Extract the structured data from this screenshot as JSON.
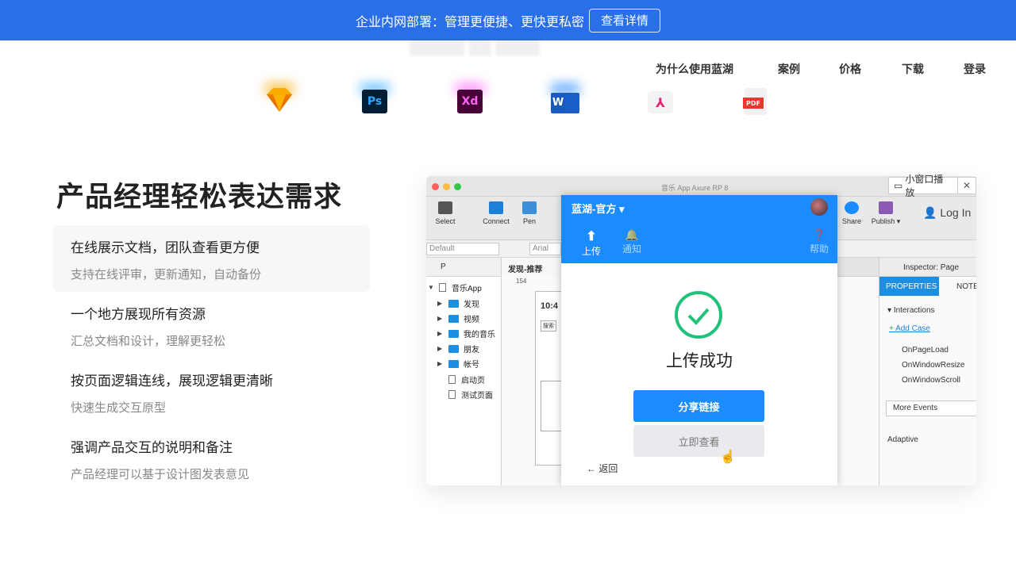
{
  "banner": {
    "text": "企业内网部署：管理更便捷、更快更私密",
    "button": "查看详情",
    "color": "#2b6fe8"
  },
  "nav": {
    "items": [
      "为什么使用蓝湖",
      "案例",
      "价格",
      "下载",
      "登录"
    ]
  },
  "tools": [
    {
      "icon": "sketch-icon",
      "label": ""
    },
    {
      "icon": "photoshop-icon",
      "label": "Ps"
    },
    {
      "icon": "adobe-xd-icon",
      "label": "Xd"
    },
    {
      "icon": "word-icon",
      "label": "W"
    },
    {
      "icon": "axure-icon",
      "label": "⅄"
    },
    {
      "icon": "pdf-icon",
      "label": "PDF"
    }
  ],
  "hero": {
    "headline": "产品经理轻松表达需求",
    "features": [
      {
        "title": "在线展示文档，团队查看更方便",
        "sub": "支持在线评审，更新通知，自动备份"
      },
      {
        "title": "一个地方展现所有资源",
        "sub": "汇总文档和设计，理解更轻松"
      },
      {
        "title": "按页面逻辑连线，展现逻辑更清晰",
        "sub": "快速生成交互原型"
      },
      {
        "title": "强调产品交互的说明和备注",
        "sub": "产品经理可以基于设计图发表意见"
      }
    ]
  },
  "screenshot": {
    "window_title": "音乐 App  Axure RP 8",
    "mini_player": "小窗口播放",
    "toolbar": [
      "Select",
      "Connect",
      "Pen",
      "More",
      "Share",
      "Publish ▾",
      "Log In"
    ],
    "style_select": "Default",
    "font_select": "Arial",
    "pages_label": "P",
    "canvas_tab": "发现-推荐",
    "ruler_value": "154",
    "tree": [
      {
        "label": "音乐App",
        "type": "doc",
        "depth": 0
      },
      {
        "label": "发现",
        "type": "folder",
        "depth": 1
      },
      {
        "label": "视频",
        "type": "folder",
        "depth": 1
      },
      {
        "label": "我的音乐",
        "type": "folder",
        "depth": 1
      },
      {
        "label": "朋友",
        "type": "folder",
        "depth": 1
      },
      {
        "label": "帐号",
        "type": "folder",
        "depth": 1
      },
      {
        "label": "启动页",
        "type": "doc",
        "depth": 1
      },
      {
        "label": "测试页面",
        "type": "doc",
        "depth": 1
      }
    ],
    "inspector": {
      "title": "Inspector: Page",
      "tabs": [
        "PROPERTIES",
        "NOTES"
      ],
      "interactions": "Interactions",
      "add_case": "Add Case",
      "events": [
        "OnPageLoad",
        "OnWindowResize",
        "OnWindowScroll"
      ],
      "more_events": "More Events",
      "adaptive": "Adaptive"
    },
    "phone": {
      "title": "蓝湖-官方 ▾",
      "tabs": [
        "上传",
        "通知",
        "帮助"
      ],
      "success": "上传成功",
      "primary_button": "分享链接",
      "secondary_button": "立即查看",
      "back": "返回",
      "time": "10:4",
      "search": "搜索"
    }
  }
}
